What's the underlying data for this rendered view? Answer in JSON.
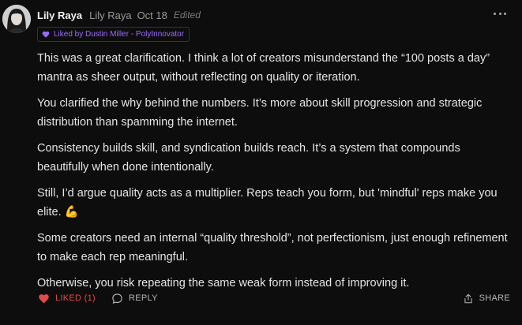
{
  "comment": {
    "author": {
      "name": "Lily Raya",
      "handle": "Lily Raya",
      "avatar_icon": "user-avatar"
    },
    "date": "Oct 18",
    "edited_label": "Edited",
    "liked_by_text": "Liked by Dustin Miller - PolyInnovator",
    "paragraphs": [
      "This was a great clarification. I think a lot of creators misunderstand the “100 posts a day” mantra as sheer output, without reflecting on quality or iteration.",
      "You clarified the why behind the numbers. It’s more about skill progression and strategic distribution than spamming the internet.",
      "Consistency builds skill, and syndication builds reach. It’s a system that compounds beautifully when done intentionally.",
      "Still, I’d argue quality acts as a multiplier. Reps teach you form, but 'mindful' reps make you elite.",
      "Some creators need an internal “quality threshold”, not perfectionism, just enough refinement to make each rep meaningful.",
      "Otherwise, you risk repeating the same weak form instead of improving it."
    ],
    "paragraph_4_emoji": "💪"
  },
  "actions": {
    "like_label": "LIKED (1)",
    "reply_label": "REPLY",
    "share_label": "SHARE"
  },
  "colors": {
    "background": "#0d0d0d",
    "liked_accent": "#e04a4a",
    "badge_accent": "#9b6bff"
  }
}
